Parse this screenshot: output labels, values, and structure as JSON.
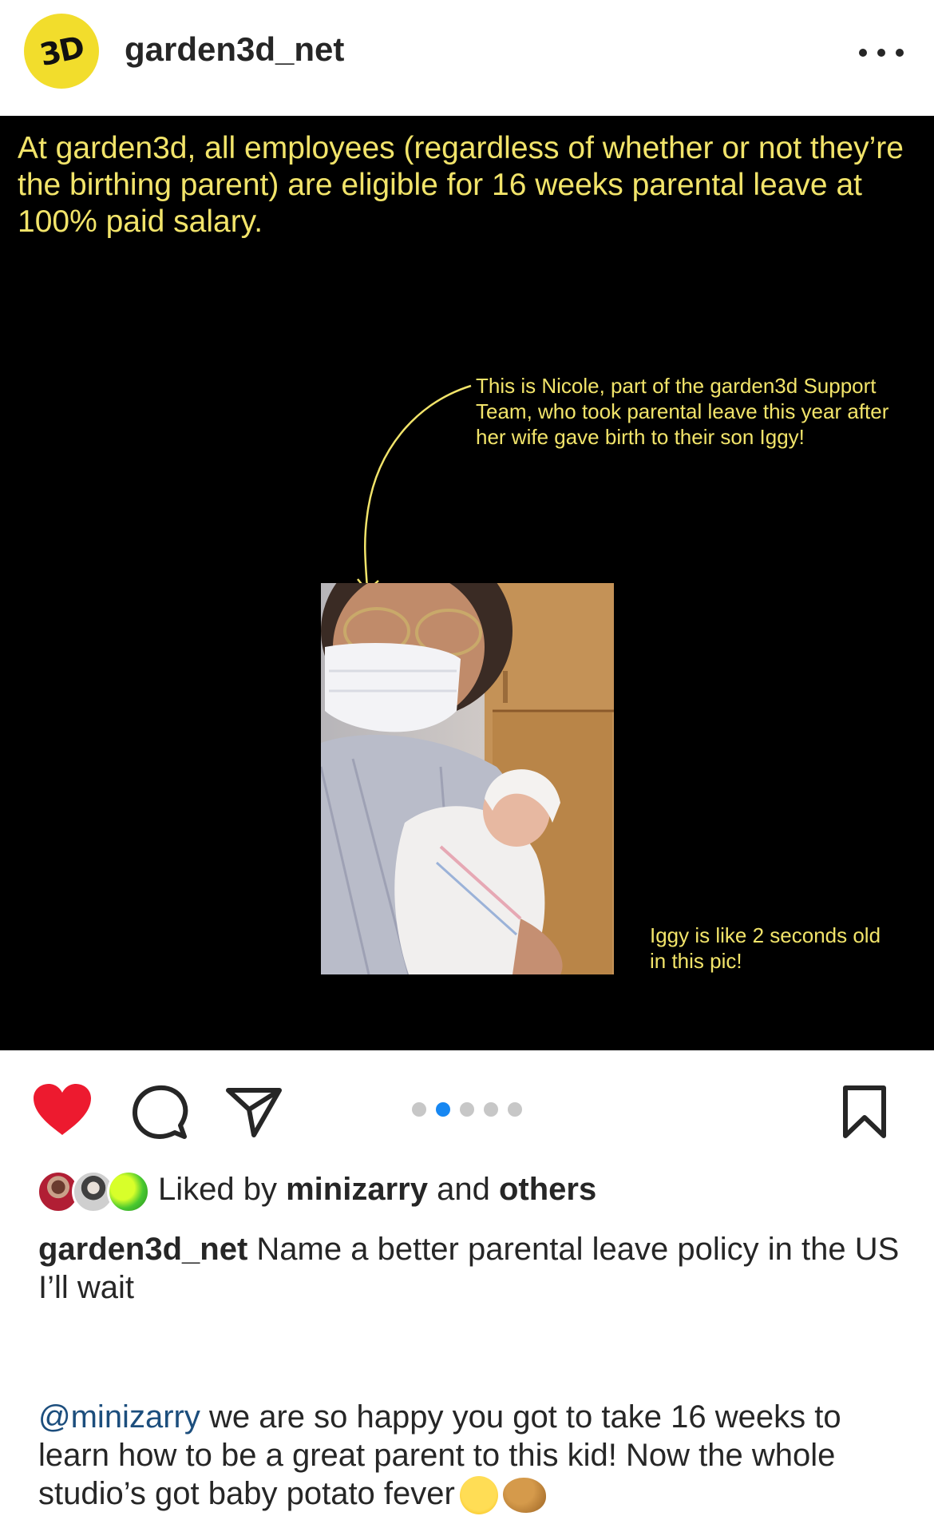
{
  "header": {
    "avatar_text": "3D",
    "username": "garden3d_net"
  },
  "post": {
    "headline": "At garden3d, all employees (regardless of whether or not they’re the birthing parent) are eligible for 16 weeks parental leave at 100% paid salary.",
    "note_nicole": "This is Nicole, part of the garden3d Support Team, who took parental leave this year after her wife gave birth to their son Iggy!",
    "note_iggy": "Iggy is like 2 seconds old in this pic!",
    "text_color": "#f2e46a",
    "background_color": "#000000"
  },
  "actions": {
    "like_icon": "heart-filled-icon",
    "comment_icon": "speech-bubble-icon",
    "share_icon": "paper-plane-icon",
    "save_icon": "bookmark-icon",
    "like_color": "#ed1a2f",
    "carousel": {
      "count": 5,
      "active_index": 1,
      "active_color": "#1787f2"
    }
  },
  "likes": {
    "prefix": "Liked by ",
    "user": "minizarry",
    "middle": " and ",
    "others": "others"
  },
  "caption": {
    "username": "garden3d_net",
    "text": " Name a better parental leave policy in the US",
    "line2": "I’ll wait"
  },
  "comment": {
    "mention": "@minizarry",
    "text": " we are so happy you got to take 16 weeks to learn how to be a great parent to this kid! Now the whole studio’s got baby potato fever",
    "emojis": [
      "sweat-smile-emoji",
      "potato-emoji"
    ]
  }
}
